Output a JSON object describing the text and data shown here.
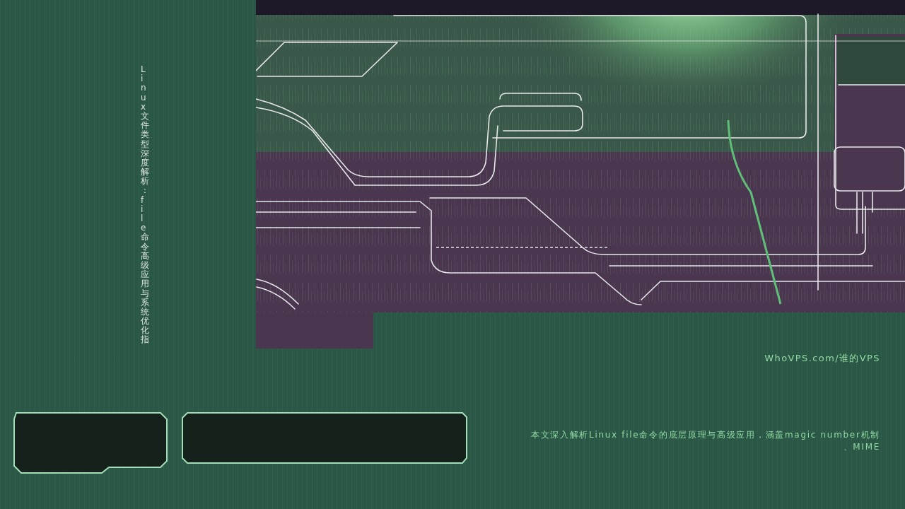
{
  "title": "Linux文件类型深度解析：file命令高级应用与系统优化指",
  "site": "WhoVPS.com/谁的VPS",
  "summary": "本文深入解析Linux file命令的底层原理与高级应用，涵盖magic number机制、MIME"
}
